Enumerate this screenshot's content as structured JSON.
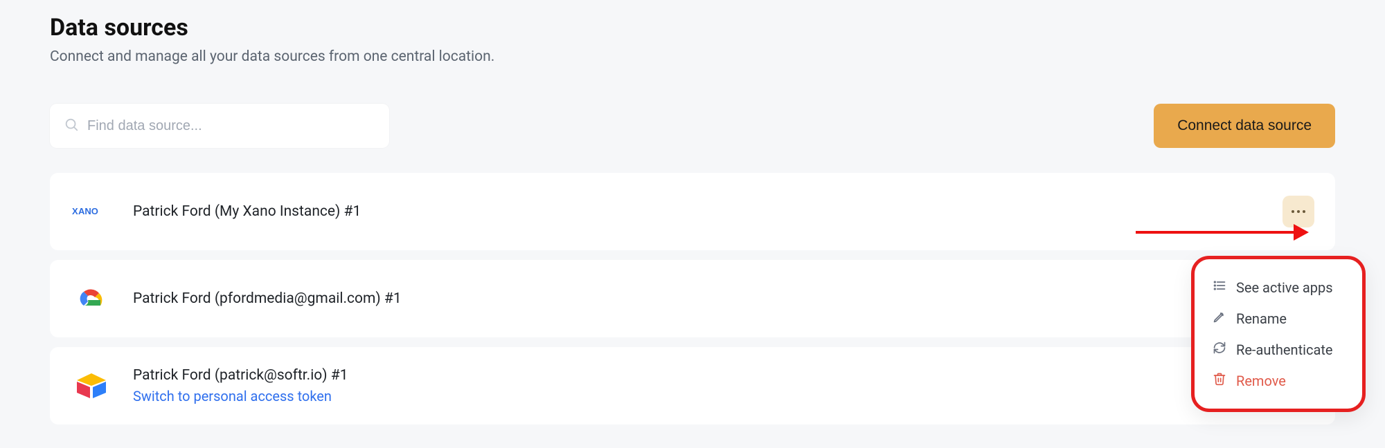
{
  "header": {
    "title": "Data sources",
    "subtitle": "Connect and manage all your data sources from one central location."
  },
  "toolbar": {
    "search_placeholder": "Find data source...",
    "connect_label": "Connect data source"
  },
  "sources": [
    {
      "name": "Patrick Ford (My Xano Instance) #1"
    },
    {
      "name": "Patrick Ford (pfordmedia@gmail.com) #1"
    },
    {
      "name": "Patrick Ford (patrick@softr.io) #1",
      "link": "Switch to personal access token"
    }
  ],
  "menu": {
    "see_apps": "See active apps",
    "rename": "Rename",
    "reauth": "Re-authenticate",
    "remove": "Remove"
  }
}
